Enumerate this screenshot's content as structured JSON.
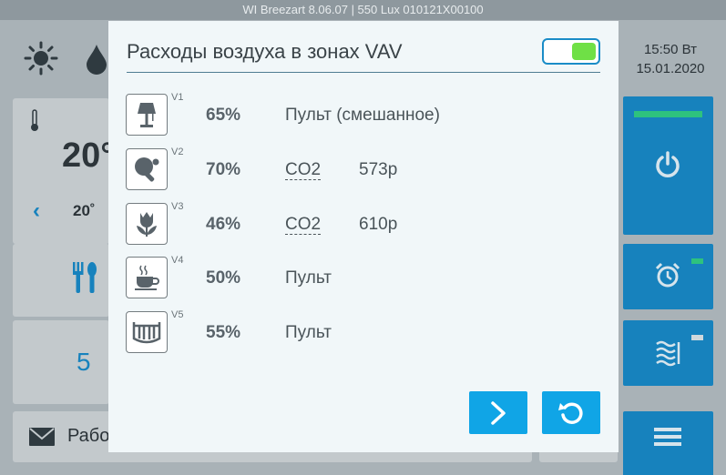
{
  "status_bar": {
    "text": "WI Breezart 8.06.07 | 550 Lux 010121X00100"
  },
  "background": {
    "sun_icon": "sun-icon",
    "drop_icon": "drop-icon",
    "thermometer_icon": "thermometer-icon",
    "temp_big": "20°",
    "temp_small": "20˚",
    "fan_speed": "5",
    "mode_label": "Рабо",
    "clock": {
      "time": "15:50 Вт",
      "date": "15.01.2020"
    },
    "accent_colors": {
      "blue": "#1782bd",
      "green": "#2ec27e"
    }
  },
  "modal": {
    "title": "Расходы воздуха в зонах VAV",
    "toggle_on": true,
    "zones": [
      {
        "id": "V1",
        "icon": "lamp-icon",
        "percent": "65%",
        "source": "Пульт (смешанное)",
        "value": ""
      },
      {
        "id": "V2",
        "icon": "table-tennis-icon",
        "percent": "70%",
        "source": "CO2",
        "value": "573p"
      },
      {
        "id": "V3",
        "icon": "tulip-icon",
        "percent": "46%",
        "source": "CO2",
        "value": "610p"
      },
      {
        "id": "V4",
        "icon": "coffee-cup-icon",
        "percent": "50%",
        "source": "Пульт",
        "value": ""
      },
      {
        "id": "V5",
        "icon": "crib-icon",
        "percent": "55%",
        "source": "Пульт",
        "value": ""
      }
    ],
    "next_icon": "chevron-right-icon",
    "refresh_icon": "refresh-icon"
  }
}
